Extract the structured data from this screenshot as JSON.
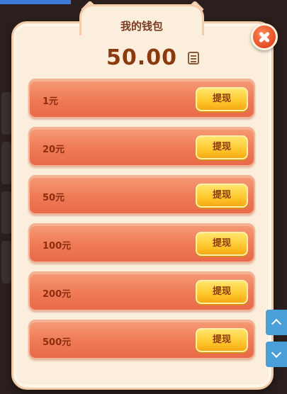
{
  "wallet": {
    "title": "我的钱包",
    "balance": "50.00"
  },
  "withdraw_options": [
    {
      "amount": "1元",
      "button": "提现"
    },
    {
      "amount": "20元",
      "button": "提现"
    },
    {
      "amount": "50元",
      "button": "提现"
    },
    {
      "amount": "100元",
      "button": "提现"
    },
    {
      "amount": "200元",
      "button": "提现"
    },
    {
      "amount": "500元",
      "button": "提现"
    }
  ],
  "icons": {
    "close": "close-icon",
    "ledger": "ledger-icon",
    "scroll_up": "chevron-up-icon",
    "scroll_down": "chevron-down-icon"
  },
  "colors": {
    "panel": "#fbeedd",
    "row": "#ef7a55",
    "button": "#ffc72c",
    "close": "#e8532a",
    "scroll": "#4a9fd8"
  }
}
